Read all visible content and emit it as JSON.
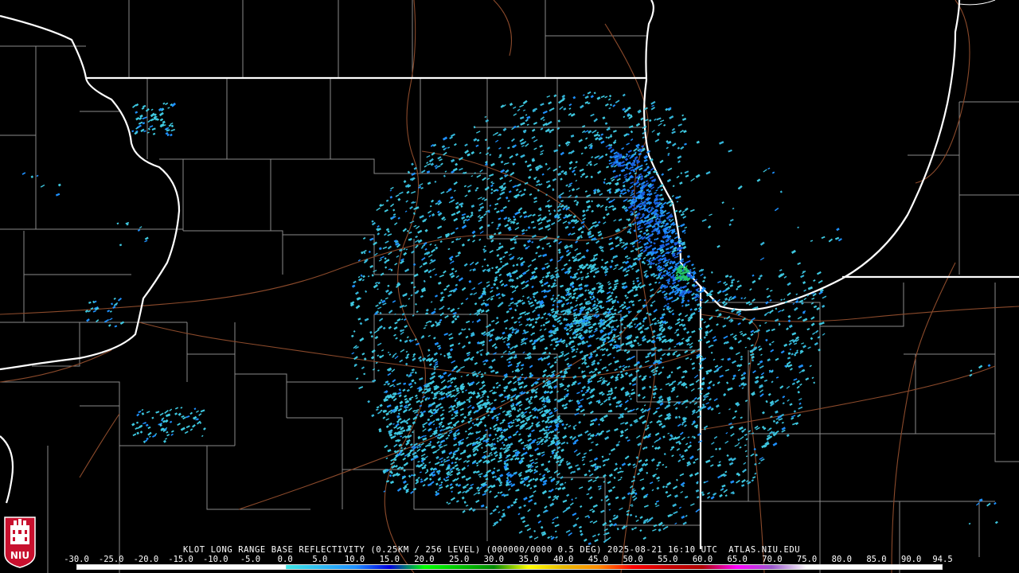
{
  "product": {
    "caption": "KLOT LONG RANGE BASE REFLECTIVITY (0.25KM / 256 LEVEL) (000000/0000 0.5 DEG) 2025-08-21 16:10 UTC  ATLAS.NIU.EDU"
  },
  "logo": {
    "text": "NIU",
    "color": "#c8102e"
  },
  "colors": {
    "background": "#000000",
    "state_border": "#ffffff",
    "county_border": "#8a8a8a",
    "highway": "#8b4a2b"
  },
  "legend": {
    "ticks": [
      "-30.0",
      "-25.0",
      "-20.0",
      "-15.0",
      "-10.0",
      "-5.0",
      "0.0",
      "5.0",
      "10.0",
      "15.0",
      "20.0",
      "25.0",
      "30.0",
      "35.0",
      "40.0",
      "45.0",
      "50.0",
      "55.0",
      "60.0",
      "65.0",
      "70.0",
      "75.0",
      "80.0",
      "85.0",
      "90.0",
      "94.5"
    ],
    "stops": [
      {
        "dbz": -30,
        "color": "#ffffff"
      },
      {
        "dbz": 0,
        "color": "#ffffff"
      },
      {
        "dbz": 0.1,
        "color": "#3ee6e6"
      },
      {
        "dbz": 10,
        "color": "#1e90ff"
      },
      {
        "dbz": 15,
        "color": "#0000e0"
      },
      {
        "dbz": 20,
        "color": "#00ff00"
      },
      {
        "dbz": 30,
        "color": "#008a00"
      },
      {
        "dbz": 35,
        "color": "#ffff00"
      },
      {
        "dbz": 40,
        "color": "#e6b800"
      },
      {
        "dbz": 45,
        "color": "#ff8c00"
      },
      {
        "dbz": 50,
        "color": "#ff0000"
      },
      {
        "dbz": 55,
        "color": "#c80000"
      },
      {
        "dbz": 60,
        "color": "#b00000"
      },
      {
        "dbz": 65,
        "color": "#ff00ff"
      },
      {
        "dbz": 70,
        "color": "#9955cc"
      },
      {
        "dbz": 75,
        "color": "#ffffff"
      },
      {
        "dbz": 94.5,
        "color": "#ffffff"
      }
    ]
  },
  "radar": {
    "site": "KLOT",
    "echo_colors": [
      "#3ec8e0",
      "#34b4d8",
      "#1e90ff",
      "#1a5fe0",
      "#22c46a"
    ]
  }
}
